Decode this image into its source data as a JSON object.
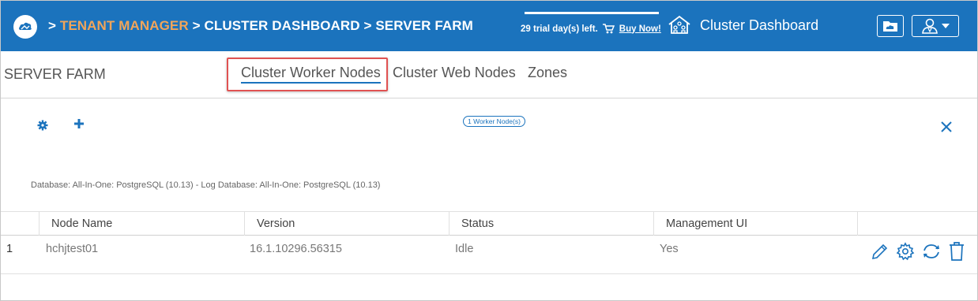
{
  "header": {
    "breadcrumb": {
      "sep1": ">",
      "tenant": "TENANT MANAGER",
      "sep2": ">",
      "cluster": "CLUSTER DASHBOARD",
      "sep3": ">",
      "farm": "SERVER FARM"
    },
    "trial_text": "29 trial day(s) left.",
    "buy_now": "Buy Now!",
    "dashboard_label": "Cluster Dashboard"
  },
  "page": {
    "section_title": "SERVER FARM",
    "tabs": [
      {
        "label": "Cluster Worker Nodes",
        "active": true
      },
      {
        "label": "Cluster Web Nodes",
        "active": false
      },
      {
        "label": "Zones",
        "active": false
      }
    ]
  },
  "toolbar": {
    "node_count_badge": "1 Worker Node(s)"
  },
  "db_info": "Database: All-In-One: PostgreSQL (10.13) - Log Database: All-In-One: PostgreSQL (10.13)",
  "table": {
    "columns": [
      "Node Name",
      "Version",
      "Status",
      "Management UI"
    ],
    "rows": [
      {
        "index": "1",
        "node_name": "hchjtest01",
        "version": "16.1.10296.56315",
        "status": "Idle",
        "management_ui": "Yes"
      }
    ]
  },
  "colors": {
    "header_bg": "#1b73bd",
    "breadcrumb_accent": "#f1a55a",
    "icon_blue": "#1b73bd",
    "highlight_red": "#e05252"
  }
}
